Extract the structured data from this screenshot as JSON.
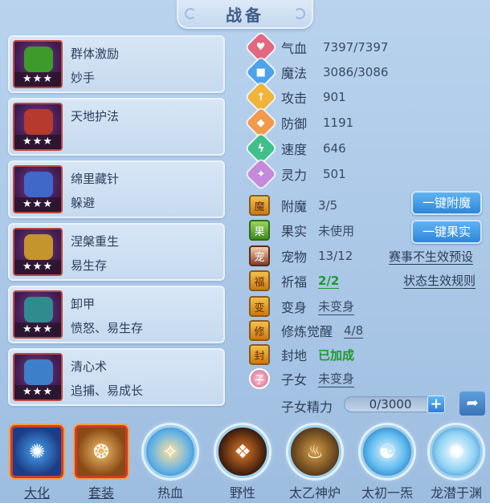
{
  "title": "战备",
  "skills": [
    {
      "name": "群体激励",
      "sub": "妙手",
      "stars": "★★★",
      "color": "#3e9a2a"
    },
    {
      "name": "天地护法",
      "sub": "",
      "stars": "★★★",
      "color": "#b63a2e"
    },
    {
      "name": "绵里藏针",
      "sub": "躲避",
      "stars": "★★★",
      "color": "#3f68c9"
    },
    {
      "name": "涅槃重生",
      "sub": "易生存",
      "stars": "★★★",
      "color": "#c4952d"
    },
    {
      "name": "卸甲",
      "sub": "愤怒、易生存",
      "stars": "★★★",
      "color": "#2f8b8e"
    },
    {
      "name": "清心术",
      "sub": "追捕、易成长",
      "stars": "★★★",
      "color": "#3d7fc8"
    }
  ],
  "stats": [
    {
      "label": "气血",
      "value": "7397/7397",
      "icon": "heart-icon",
      "color": "#e2677f",
      "glyph": "♥"
    },
    {
      "label": "魔法",
      "value": "3086/3086",
      "icon": "mana-icon",
      "color": "#4da3e7",
      "glyph": "■"
    },
    {
      "label": "攻击",
      "value": "901",
      "icon": "attack-icon",
      "color": "#f0b43a",
      "glyph": "↑"
    },
    {
      "label": "防御",
      "value": "1191",
      "icon": "defense-icon",
      "color": "#f09a4a",
      "glyph": "◆"
    },
    {
      "label": "速度",
      "value": "646",
      "icon": "speed-icon",
      "color": "#3fc08a",
      "glyph": "ϟ"
    },
    {
      "label": "灵力",
      "value": "501",
      "icon": "spirit-icon",
      "color": "#c58ad9",
      "glyph": "✦"
    }
  ],
  "misc": [
    {
      "label": "附魔",
      "value": "3/5",
      "style": "plain",
      "icon": "enchant-icon"
    },
    {
      "label": "果实",
      "value": "未使用",
      "style": "plain",
      "icon": "fruit-icon"
    },
    {
      "label": "宠物",
      "value": "13/12",
      "style": "plain",
      "icon": "pet-icon"
    },
    {
      "label": "祈福",
      "value": "2/2",
      "style": "green-under",
      "icon": "blessing-icon"
    },
    {
      "label": "变身",
      "value": "未变身",
      "style": "under",
      "icon": "transform-icon"
    },
    {
      "label": "修炼觉醒",
      "value": "4/8",
      "style": "under",
      "icon": "cultivation-icon"
    },
    {
      "label": "封地",
      "value": "已加成",
      "style": "green",
      "icon": "fief-icon"
    },
    {
      "label": "子女",
      "value": "未变身",
      "style": "under",
      "icon": "child-icon"
    }
  ],
  "buttons": {
    "enchant": "一键附魔",
    "fruit": "一键果实"
  },
  "links": {
    "preset": "赛事不生效预设",
    "rules": "状态生效规则"
  },
  "energy": {
    "label": "子女精力",
    "value": "0/3000",
    "plus": "+"
  },
  "tabs": [
    {
      "label": "大化",
      "style": "square",
      "under": true
    },
    {
      "label": "套装",
      "style": "square",
      "under": true
    },
    {
      "label": "热血",
      "style": "circle",
      "under": false
    },
    {
      "label": "野性",
      "style": "circle",
      "under": false
    },
    {
      "label": "太乙神炉",
      "style": "circle",
      "under": false
    },
    {
      "label": "太初一炁",
      "style": "circle",
      "under": false
    },
    {
      "label": "龙潜于渊",
      "style": "circle",
      "under": false
    }
  ]
}
